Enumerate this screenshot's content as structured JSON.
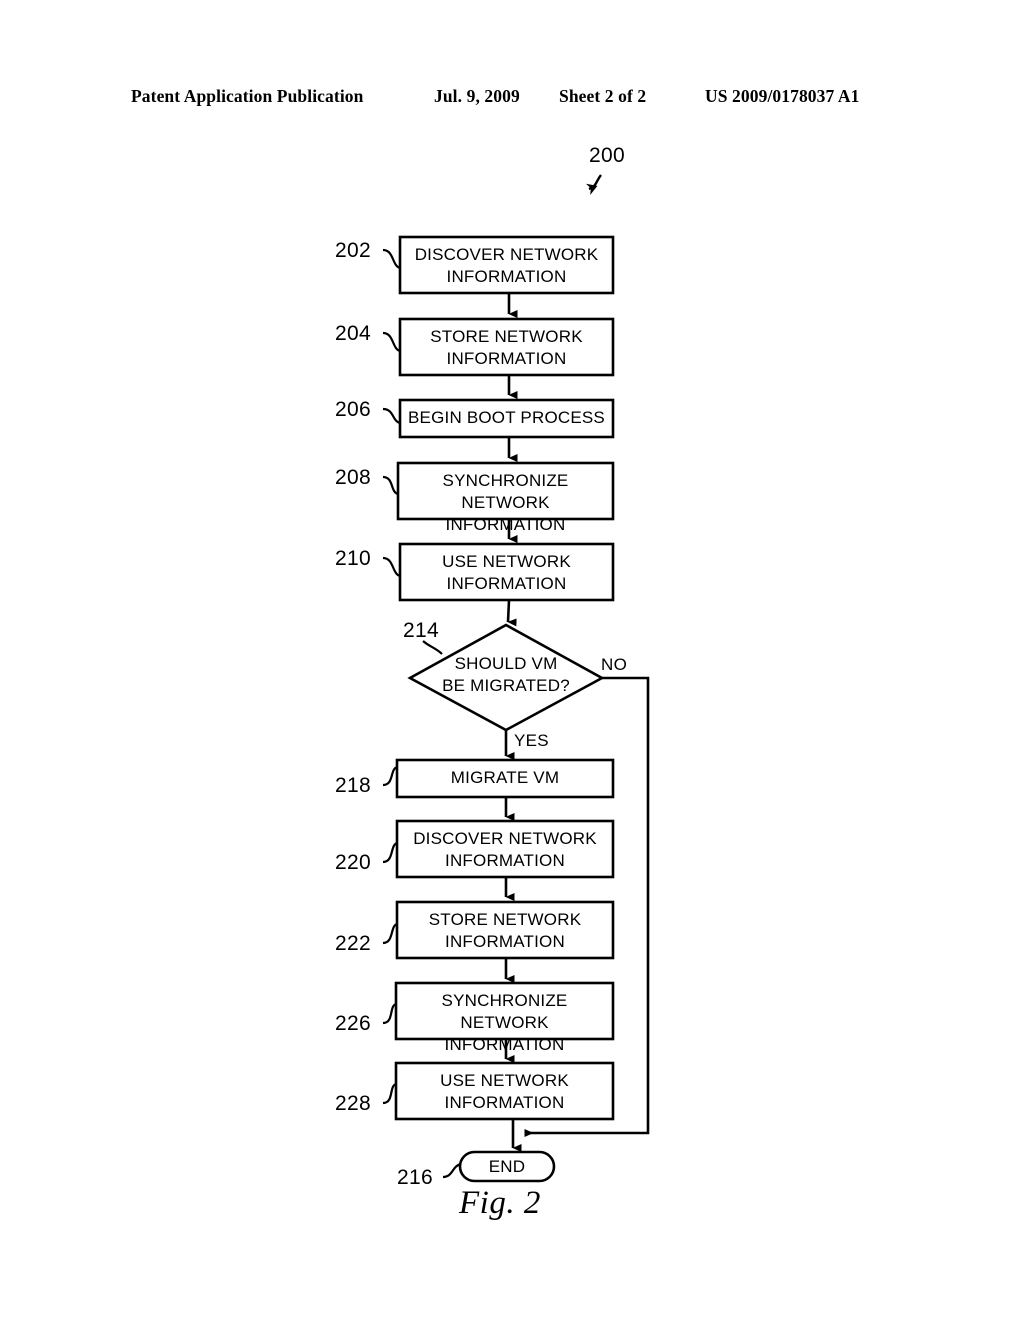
{
  "header": {
    "publication": "Patent Application Publication",
    "date": "Jul. 9, 2009",
    "sheet": "Sheet 2 of 2",
    "patent_number": "US 2009/0178037 A1"
  },
  "figure": {
    "caption": "Fig. 2",
    "diagram_ref": "200",
    "nodes": [
      {
        "ref": "202",
        "text": "DISCOVER NETWORK\nINFORMATION",
        "shape": "process"
      },
      {
        "ref": "204",
        "text": "STORE NETWORK\nINFORMATION",
        "shape": "process"
      },
      {
        "ref": "206",
        "text": "BEGIN BOOT PROCESS",
        "shape": "process"
      },
      {
        "ref": "208",
        "text": "SYNCHRONIZE NETWORK\nINFORMATION",
        "shape": "process"
      },
      {
        "ref": "210",
        "text": "USE NETWORK\nINFORMATION",
        "shape": "process"
      },
      {
        "ref": "214",
        "text": "SHOULD VM\nBE MIGRATED?",
        "shape": "decision"
      },
      {
        "ref": "218",
        "text": "MIGRATE VM",
        "shape": "process"
      },
      {
        "ref": "220",
        "text": "DISCOVER NETWORK\nINFORMATION",
        "shape": "process"
      },
      {
        "ref": "222",
        "text": "STORE NETWORK\nINFORMATION",
        "shape": "process"
      },
      {
        "ref": "226",
        "text": "SYNCHRONIZE NETWORK\nINFORMATION",
        "shape": "process"
      },
      {
        "ref": "228",
        "text": "USE NETWORK\nINFORMATION",
        "shape": "process"
      },
      {
        "ref": "216",
        "text": "END",
        "shape": "terminator"
      }
    ],
    "branch_labels": {
      "no": "NO",
      "yes": "YES"
    }
  }
}
